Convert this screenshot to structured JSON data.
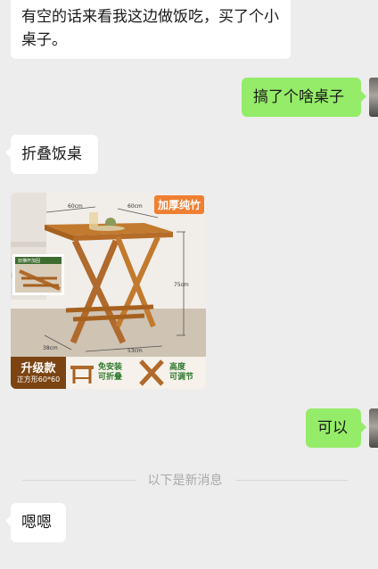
{
  "messages": [
    {
      "dir": "in",
      "text": "有空的话来看我这边做饭吃，买了个小桌子。"
    },
    {
      "dir": "out",
      "text": "搞了个啥桌子"
    },
    {
      "dir": "in",
      "text": "折叠饭桌"
    },
    {
      "dir": "in_image",
      "image": {
        "badge": "加厚纯竹",
        "dim_top_left": "60cm",
        "dim_top_right": "60cm",
        "dim_height": "75cm",
        "dim_bottom_left": "38cm",
        "dim_bottom_right": "53cm",
        "inset_label": "双横杆加固",
        "upgrade_title": "升级款",
        "upgrade_sub": "正方形60*60",
        "feature1_line1": "免安装",
        "feature1_line2": "可折叠",
        "feature2_line1": "高度",
        "feature2_line2": "可调节"
      }
    },
    {
      "dir": "out",
      "text": "可以"
    },
    {
      "dir": "in",
      "text": "嗯嗯"
    }
  ],
  "divider_label": "以下是新消息",
  "colors": {
    "background": "#ededed",
    "incoming": "#ffffff",
    "outgoing": "#95ec69",
    "badge": "#ef7f31"
  }
}
